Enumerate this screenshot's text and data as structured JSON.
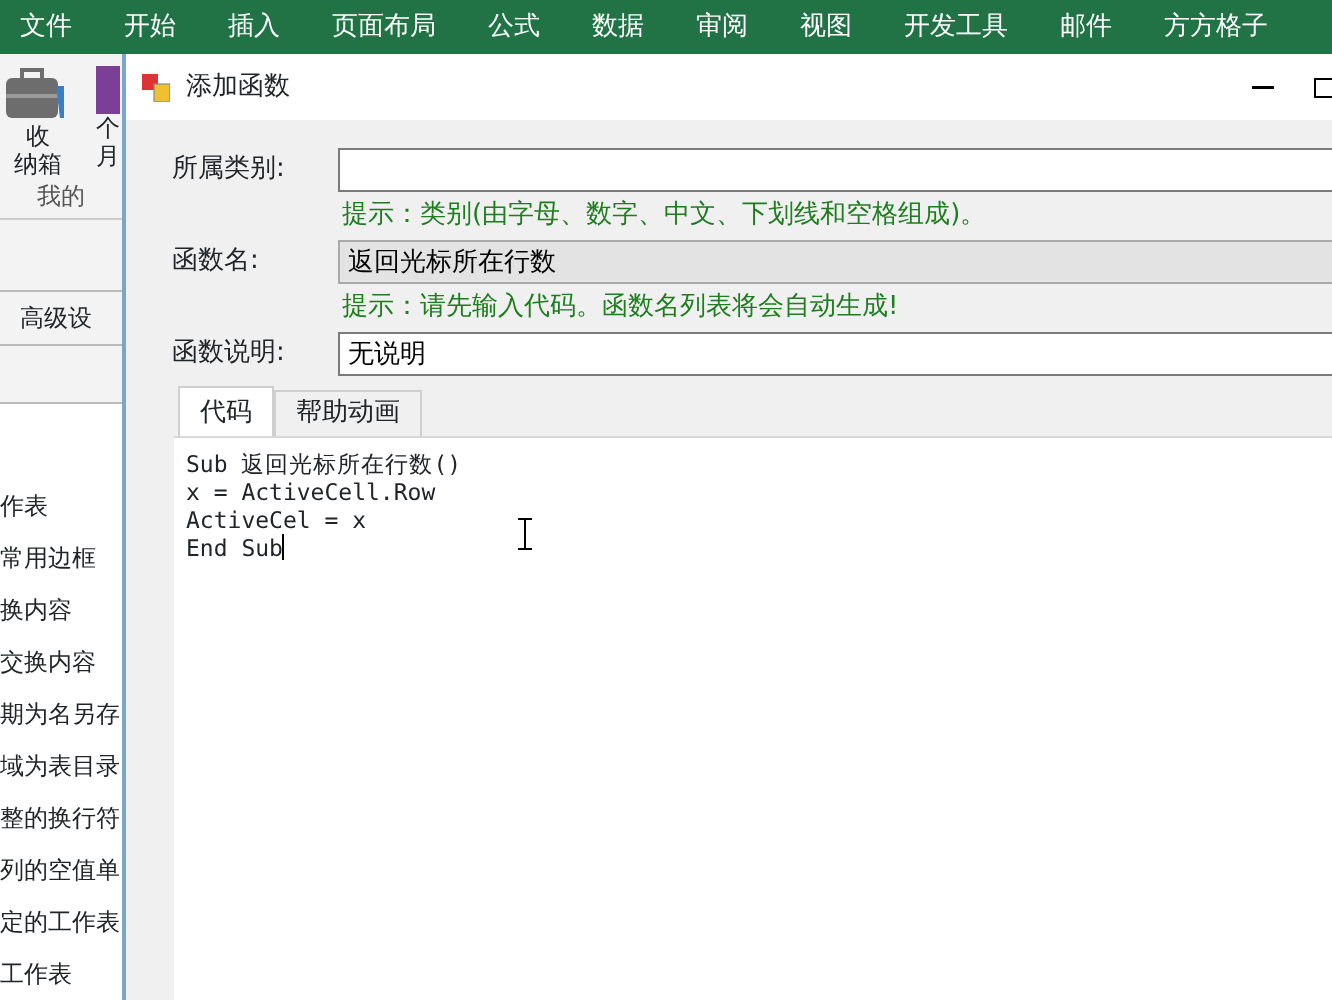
{
  "ribbon_tabs": [
    "文件",
    "开始",
    "插入",
    "页面布局",
    "公式",
    "数据",
    "审阅",
    "视图",
    "开发工具",
    "邮件",
    "方方格子"
  ],
  "left_panel": {
    "toolbox_label": [
      "收",
      "纳箱"
    ],
    "next_button_label": [
      "个",
      "月"
    ],
    "group_label": "我的",
    "advanced_tab": "高级设",
    "items": [
      "作表",
      "常用边框",
      "换内容",
      "交换内容",
      "期为名另存",
      "域为表目录",
      "整的换行符",
      "列的空值单",
      "定的工作表",
      "工作表"
    ]
  },
  "dialog": {
    "title": "添加函数",
    "fields": [
      {
        "label": "所属类别:",
        "readonly": false,
        "hint": "提示：类别(由字母、数字、中文、下划线和空格组成)。"
      },
      {
        "label": "函数名:",
        "value": "返回光标所在行数",
        "readonly": true,
        "hint": "提示：请先输入代码。函数名列表将会自动生成!"
      },
      {
        "label": "函数说明:",
        "value": "无说明",
        "readonly": false
      }
    ],
    "tabs": [
      {
        "label": "代码",
        "selected": true
      },
      {
        "label": "帮助动画",
        "selected": false
      }
    ],
    "code_lines": [
      "Sub 返回光标所在行数()",
      "x = ActiveCell.Row",
      "ActiveCel = x",
      "End Sub"
    ]
  }
}
